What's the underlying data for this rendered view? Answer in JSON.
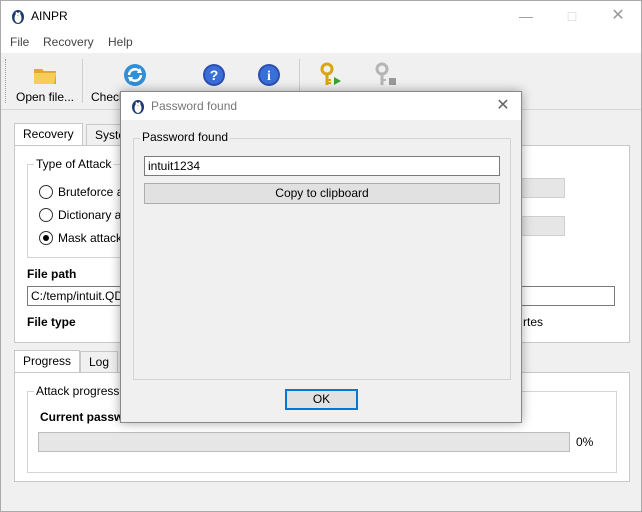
{
  "window": {
    "title": "AINPR"
  },
  "menu": [
    "File",
    "Recovery",
    "Help"
  ],
  "toolbar": {
    "open_label": "Open file...",
    "check_label": "Check"
  },
  "recovery_tabs": [
    "Recovery",
    "Syste"
  ],
  "attack": {
    "group_title": "Type of Attack",
    "options": [
      "Bruteforce at",
      "Dictionary att",
      "Mask attack"
    ],
    "selected": "Mask attack"
  },
  "file": {
    "path_label": "File path",
    "path_value": "C:/temp/intuit.QDF",
    "type_label": "File type",
    "size_suffix": "rtes"
  },
  "progress_tabs": [
    "Progress",
    "Log"
  ],
  "progress": {
    "group_title": "Attack progress",
    "current_label": "Current passw",
    "percent": "0%",
    "fraction": 0.0
  },
  "dialog": {
    "title": "Password found",
    "group_title": "Password found",
    "password": "intuit1234",
    "copy_label": "Copy to clipboard",
    "ok_label": "OK"
  }
}
